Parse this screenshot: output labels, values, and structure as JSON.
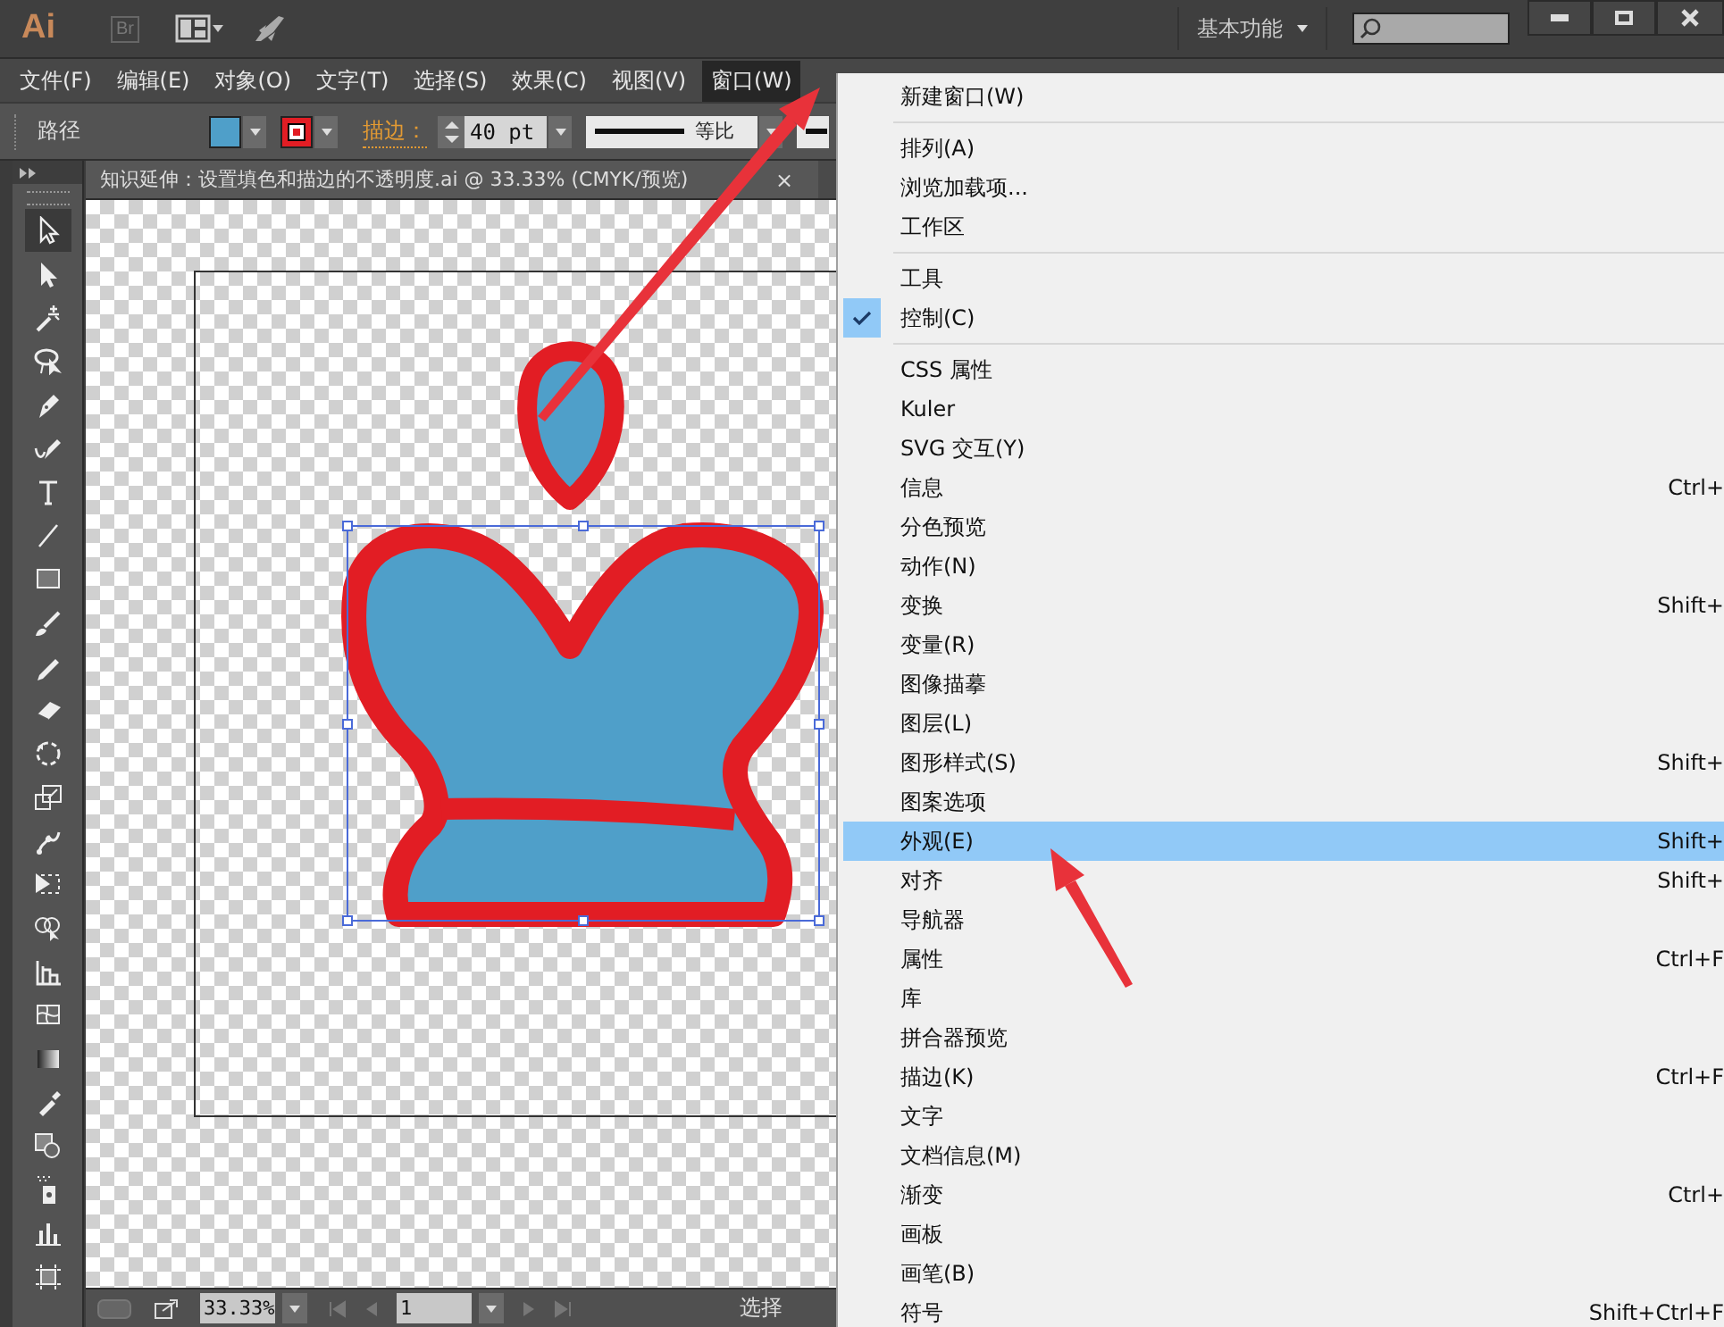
{
  "title_bar": {
    "logo": "Ai",
    "bridge": "Br",
    "workspace": "基本功能"
  },
  "menu_bar": [
    {
      "label": "文件(F)",
      "selected": false
    },
    {
      "label": "编辑(E)",
      "selected": false
    },
    {
      "label": "对象(O)",
      "selected": false
    },
    {
      "label": "文字(T)",
      "selected": false
    },
    {
      "label": "选择(S)",
      "selected": false
    },
    {
      "label": "效果(C)",
      "selected": false
    },
    {
      "label": "视图(V)",
      "selected": false
    },
    {
      "label": "窗口(W)",
      "selected": true
    }
  ],
  "control_bar": {
    "object_type": "路径",
    "stroke_label": "描边：",
    "stroke_weight": "40 pt",
    "profile": "等比"
  },
  "document_tab": {
    "title": "知识延伸：设置填色和描边的不透明度.ai @ 33.33% (CMYK/预览)",
    "close": "×"
  },
  "status_bar": {
    "zoom": "33.33%",
    "artboard": "1",
    "tool": "选择"
  },
  "window_menu": [
    {
      "kind": "item",
      "label": "新建窗口(W)",
      "checked": false,
      "selected": false
    },
    {
      "kind": "separator"
    },
    {
      "kind": "item",
      "label": "排列(A)",
      "checked": false,
      "selected": false
    },
    {
      "kind": "item",
      "label": "浏览加载项...",
      "checked": false,
      "selected": false
    },
    {
      "kind": "item",
      "label": "工作区",
      "checked": false,
      "selected": false
    },
    {
      "kind": "separator"
    },
    {
      "kind": "item",
      "label": "工具",
      "checked": false,
      "selected": false
    },
    {
      "kind": "item",
      "label": "控制(C)",
      "checked": true,
      "selected": false
    },
    {
      "kind": "separator"
    },
    {
      "kind": "item",
      "label": "CSS 属性",
      "checked": false,
      "selected": false
    },
    {
      "kind": "item",
      "label": "Kuler",
      "checked": false,
      "selected": false
    },
    {
      "kind": "item",
      "label": "SVG 交互(Y)",
      "checked": false,
      "selected": false
    },
    {
      "kind": "item",
      "label": "信息",
      "shortcut": "Ctrl+",
      "checked": false,
      "selected": false
    },
    {
      "kind": "item",
      "label": "分色预览",
      "checked": false,
      "selected": false
    },
    {
      "kind": "item",
      "label": "动作(N)",
      "checked": false,
      "selected": false
    },
    {
      "kind": "item",
      "label": "变换",
      "shortcut": "Shift+",
      "checked": false,
      "selected": false
    },
    {
      "kind": "item",
      "label": "变量(R)",
      "checked": false,
      "selected": false
    },
    {
      "kind": "item",
      "label": "图像描摹",
      "checked": false,
      "selected": false
    },
    {
      "kind": "item",
      "label": "图层(L)",
      "checked": false,
      "selected": false
    },
    {
      "kind": "item",
      "label": "图形样式(S)",
      "shortcut": "Shift+",
      "checked": false,
      "selected": false
    },
    {
      "kind": "item",
      "label": "图案选项",
      "checked": false,
      "selected": false
    },
    {
      "kind": "item",
      "label": "外观(E)",
      "shortcut": "Shift+",
      "checked": false,
      "selected": true
    },
    {
      "kind": "item",
      "label": "对齐",
      "shortcut": "Shift+",
      "checked": false,
      "selected": false
    },
    {
      "kind": "item",
      "label": "导航器",
      "checked": false,
      "selected": false
    },
    {
      "kind": "item",
      "label": "属性",
      "shortcut": "Ctrl+F",
      "checked": false,
      "selected": false
    },
    {
      "kind": "item",
      "label": "库",
      "checked": false,
      "selected": false
    },
    {
      "kind": "item",
      "label": "拼合器预览",
      "checked": false,
      "selected": false
    },
    {
      "kind": "item",
      "label": "描边(K)",
      "shortcut": "Ctrl+F",
      "checked": false,
      "selected": false
    },
    {
      "kind": "item",
      "label": "文字",
      "checked": false,
      "selected": false
    },
    {
      "kind": "item",
      "label": "文档信息(M)",
      "checked": false,
      "selected": false
    },
    {
      "kind": "item",
      "label": "渐变",
      "shortcut": "Ctrl+",
      "checked": false,
      "selected": false
    },
    {
      "kind": "item",
      "label": "画板",
      "checked": false,
      "selected": false
    },
    {
      "kind": "item",
      "label": "画笔(B)",
      "checked": false,
      "selected": false
    },
    {
      "kind": "item",
      "label": "符号",
      "shortcut": "Shift+Ctrl+F",
      "checked": false,
      "selected": false
    }
  ]
}
